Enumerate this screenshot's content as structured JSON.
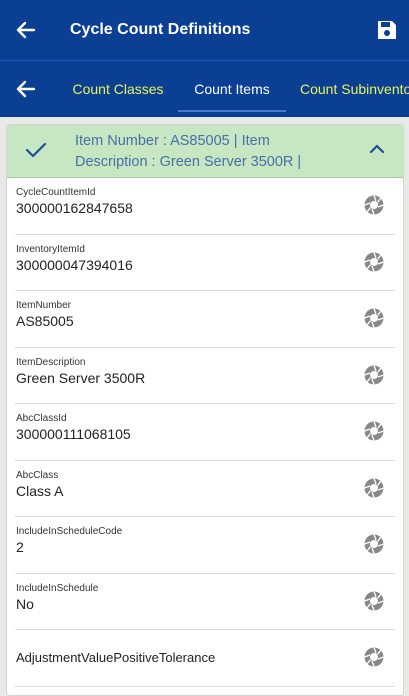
{
  "app": {
    "title": "Cycle Count Definitions"
  },
  "tabs": [
    {
      "label": "Count Classes"
    },
    {
      "label": "Count Items"
    },
    {
      "label": "Count Subinventories"
    }
  ],
  "card": {
    "header_line1": "Item Number : AS85005 | Item",
    "header_line2": "Description : Green Server 3500R |"
  },
  "fields": [
    {
      "label": "CycleCountItemId",
      "value": "300000162847658"
    },
    {
      "label": "InventoryItemId",
      "value": "300000047394016"
    },
    {
      "label": "ItemNumber",
      "value": "AS85005"
    },
    {
      "label": "ItemDescription",
      "value": "Green Server 3500R"
    },
    {
      "label": "AbcClassId",
      "value": "300000111068105"
    },
    {
      "label": "AbcClass",
      "value": "Class A"
    },
    {
      "label": "IncludeInScheduleCode",
      "value": "2"
    },
    {
      "label": "IncludeInSchedule",
      "value": "No"
    },
    {
      "label": "AdjustmentValuePositiveTolerance",
      "value": ""
    }
  ],
  "colors": {
    "header_bg": "#0a3f93",
    "tab_inactive": "#e8f35b",
    "card_header_bg": "#c7e6c2",
    "card_header_text": "#4a6fa8"
  },
  "icons": {
    "back": "arrow-left-icon",
    "save": "floppy-disk-icon",
    "check": "check-icon",
    "collapse": "chevron-up-icon",
    "row_action": "camera-aperture-icon"
  }
}
